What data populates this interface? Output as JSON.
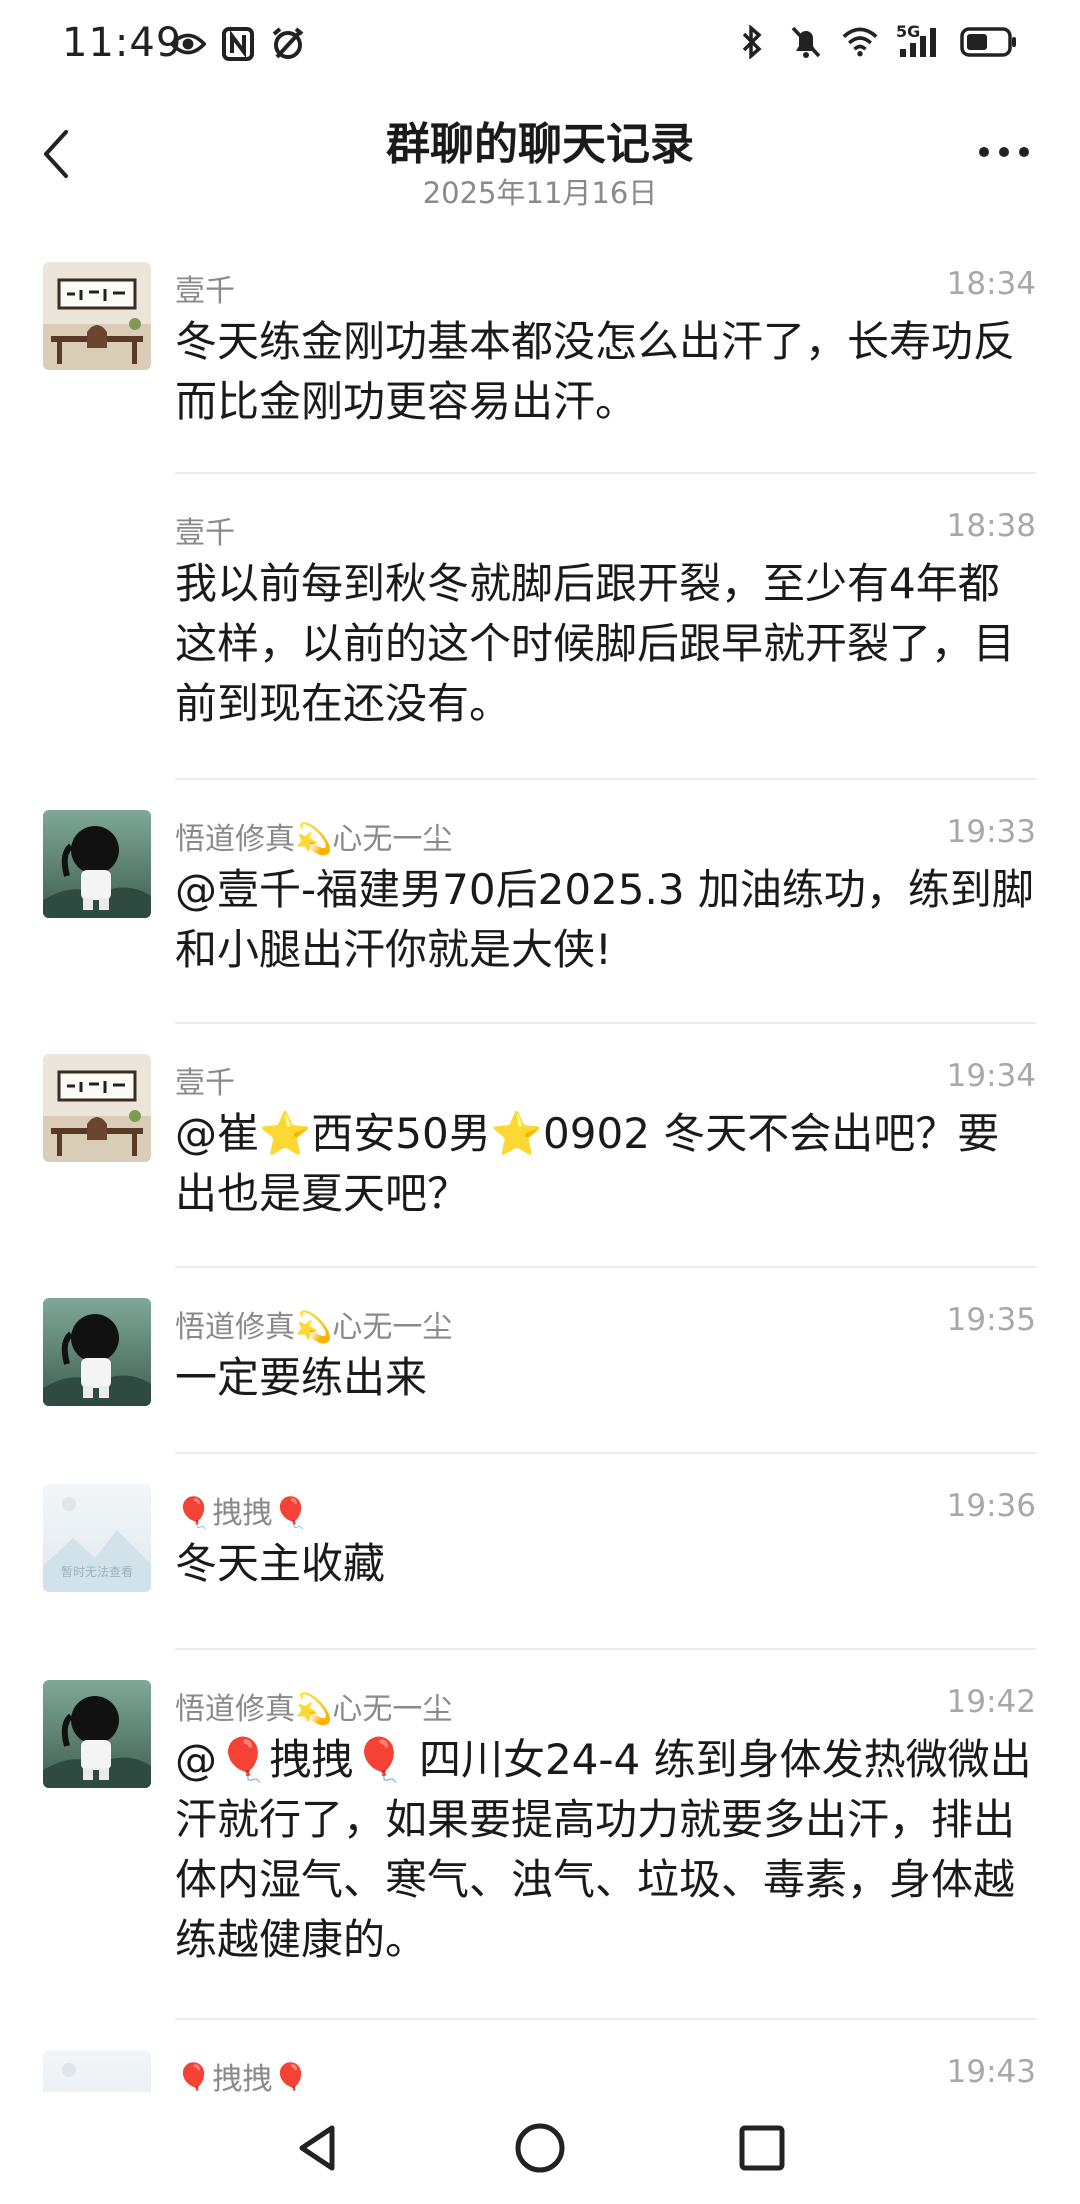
{
  "status_bar": {
    "time": "11:49",
    "left_icons": [
      "eye-icon",
      "nfc-icon",
      "alarm-icon"
    ],
    "right_icons": [
      "bluetooth-icon",
      "mute-icon",
      "wifi-icon",
      "5g-signal-icon",
      "battery-icon"
    ],
    "network_label": "5G"
  },
  "header": {
    "title": "群聊的聊天记录",
    "date": "2025年11月16日"
  },
  "messages": [
    {
      "sender": "壹千",
      "time": "18:34",
      "text": "冬天练金刚功基本都没怎么出汗了，长寿功反而比金刚功更容易出汗。",
      "avatar": "calligraphy",
      "show_avatar": true
    },
    {
      "sender": "壹千",
      "time": "18:38",
      "text": "我以前每到秋冬就脚后跟开裂，至少有4年都这样，以前的这个时候脚后跟早就开裂了，目前到现在还没有。",
      "avatar": "none",
      "show_avatar": false
    },
    {
      "sender": "悟道修真💫心无一尘",
      "time": "19:33",
      "text": "@壹千-福建男70后2025.3 加油练功，练到脚和小腿出汗你就是大侠!",
      "avatar": "ninja",
      "show_avatar": true
    },
    {
      "sender": "壹千",
      "time": "19:34",
      "text": "@崔⭐西安50男⭐0902 冬天不会出吧？要出也是夏天吧？",
      "avatar": "calligraphy",
      "show_avatar": true
    },
    {
      "sender": "悟道修真💫心无一尘",
      "time": "19:35",
      "text": "一定要练出来",
      "avatar": "ninja",
      "show_avatar": true
    },
    {
      "sender": "🎈拽拽🎈",
      "time": "19:36",
      "text": "冬天主收藏",
      "avatar": "placeholder",
      "show_avatar": true
    },
    {
      "sender": "悟道修真💫心无一尘",
      "time": "19:42",
      "text": "@🎈拽拽🎈 四川女24-4 练到身体发热微微出汗就行了，如果要提高功力就要多出汗，排出体内湿气、寒气、浊气、垃圾、毒素，身体越练越健康的。",
      "avatar": "ninja",
      "show_avatar": true
    },
    {
      "sender": "🎈拽拽🎈",
      "time": "19:43",
      "text": "",
      "avatar": "placeholder",
      "show_avatar": true
    }
  ],
  "avatar_placeholder_text": "暂时无法查看",
  "nav": {
    "back": "back-triangle-icon",
    "home": "home-circle-icon",
    "recents": "recents-square-icon"
  },
  "colors": {
    "text": "#1a1a1a",
    "meta": "#8a8a8a",
    "time": "#a8a8a8",
    "divider": "#ececec"
  }
}
